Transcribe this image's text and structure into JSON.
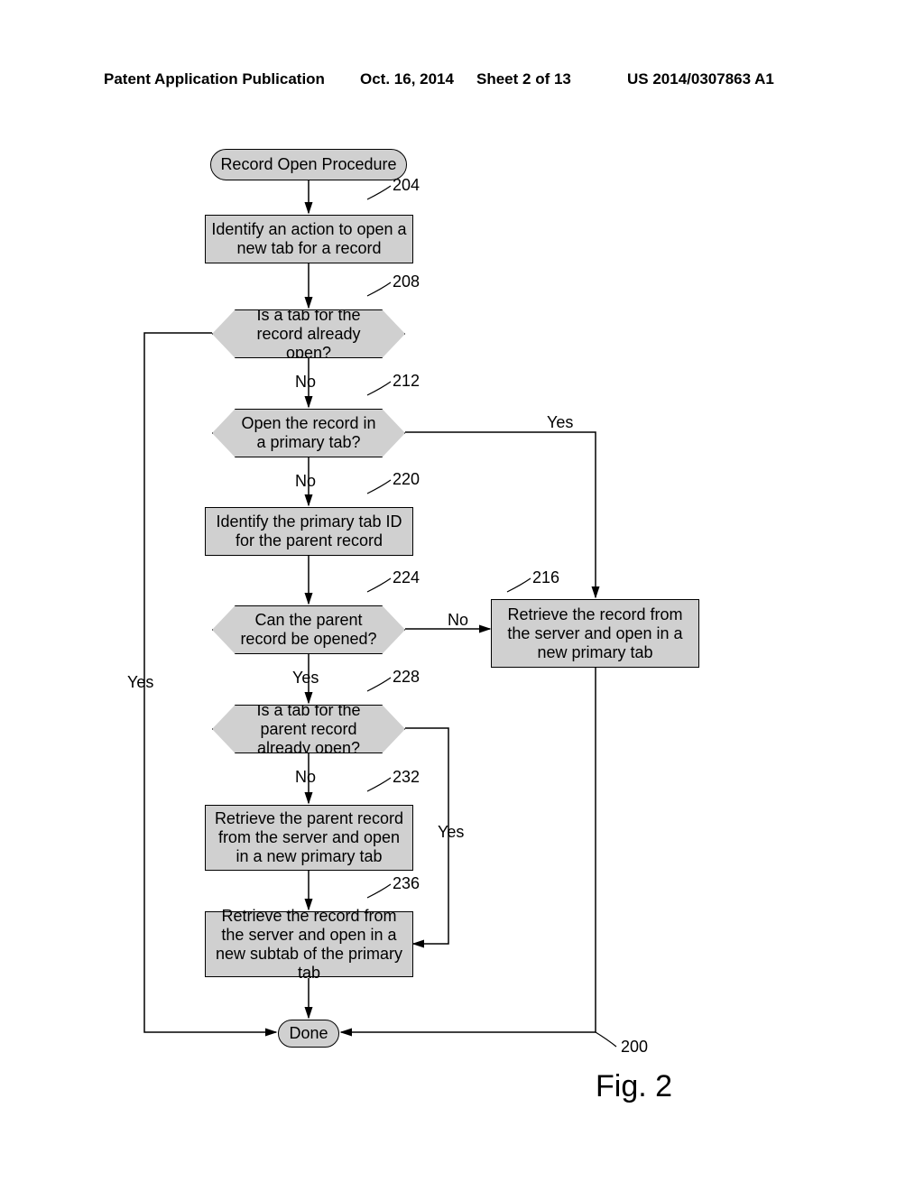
{
  "header": {
    "pubtype": "Patent Application Publication",
    "date": "Oct. 16, 2014",
    "sheet": "Sheet 2 of 13",
    "pubnum": "US 2014/0307863 A1"
  },
  "figure_label": "Fig. 2",
  "nodes": {
    "start": "Record Open Procedure",
    "n204": "Identify an action to open a new tab for a record",
    "n208": "Is a tab for the record already open?",
    "n212": "Open the record in a primary tab?",
    "n220": "Identify the primary tab ID for the parent record",
    "n224": "Can the parent record be opened?",
    "n216": "Retrieve the record from the server and open in a new primary tab",
    "n228": "Is a tab for the parent record already open?",
    "n232": "Retrieve the parent record from the server and open in a new primary tab",
    "n236": "Retrieve the record from the server and open in a new subtab of the primary tab",
    "done": "Done"
  },
  "refs": {
    "r204": "204",
    "r208": "208",
    "r212": "212",
    "r220": "220",
    "r224": "224",
    "r216": "216",
    "r228": "228",
    "r232": "232",
    "r236": "236",
    "r200": "200"
  },
  "edges": {
    "yes": "Yes",
    "no": "No"
  }
}
